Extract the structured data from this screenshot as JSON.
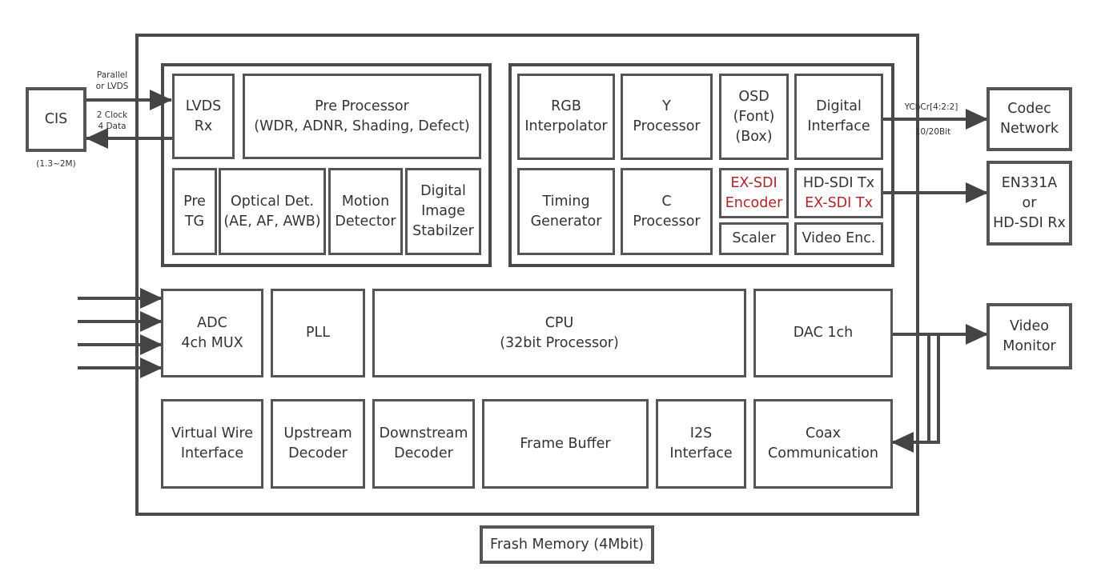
{
  "colors": {
    "stroke": "#4a4a4a",
    "accent_red": "#b0242a"
  },
  "external": {
    "cis": {
      "lines": [
        "CIS"
      ],
      "note": "(1.3~2M)"
    },
    "codec": {
      "lines": [
        "Codec",
        "Network"
      ]
    },
    "en331a": {
      "lines": [
        "EN331A",
        "or",
        "HD-SDI Rx"
      ]
    },
    "video_monitor": {
      "lines": [
        "Video",
        "Monitor"
      ]
    },
    "flash": {
      "lines": [
        "Frash Memory (4Mbit)"
      ]
    }
  },
  "signals": {
    "parallel": [
      "Parallel",
      "or LVDS"
    ],
    "clock": [
      "2 Clock",
      "4 Data"
    ],
    "ycbcr": "YCbCr[4:2:2]",
    "bits": "10/20Bit"
  },
  "blocks": {
    "lvds_rx": [
      "LVDS",
      "Rx"
    ],
    "pre_processor": [
      "Pre Processor",
      "(WDR, ADNR, Shading, Defect)"
    ],
    "pre_tg": [
      "Pre",
      "TG"
    ],
    "optical_det": [
      "Optical Det.",
      "(AE, AF, AWB)"
    ],
    "motion_detector": [
      "Motion",
      "Detector"
    ],
    "dis": [
      "Digital",
      "Image",
      "Stabilzer"
    ],
    "rgb_interp": [
      "RGB",
      "Interpolator"
    ],
    "y_processor": [
      "Y",
      "Processor"
    ],
    "osd": [
      "OSD",
      "(Font)",
      "(Box)"
    ],
    "digital_interface": [
      "Digital",
      "Interface"
    ],
    "timing_generator": [
      "Timing",
      "Generator"
    ],
    "c_processor": [
      "C",
      "Processor"
    ],
    "exsdi_encoder": [
      "EX-SDI",
      "Encoder"
    ],
    "hdsdi_tx": [
      "HD-SDI Tx",
      "EX-SDI Tx"
    ],
    "scaler": [
      "Scaler"
    ],
    "video_enc": [
      "Video Enc."
    ],
    "adc": [
      "ADC",
      "4ch MUX"
    ],
    "pll": [
      "PLL"
    ],
    "cpu": [
      "CPU",
      "(32bit Processor)"
    ],
    "dac": [
      "DAC 1ch"
    ],
    "virtual_wire": [
      "Virtual Wire",
      "Interface"
    ],
    "upstream": [
      "Upstream",
      "Decoder"
    ],
    "downstream": [
      "Downstream",
      "Decoder"
    ],
    "frame_buffer": [
      "Frame Buffer"
    ],
    "i2s": [
      "I2S",
      "Interface"
    ],
    "coax": [
      "Coax",
      "Communication"
    ]
  }
}
